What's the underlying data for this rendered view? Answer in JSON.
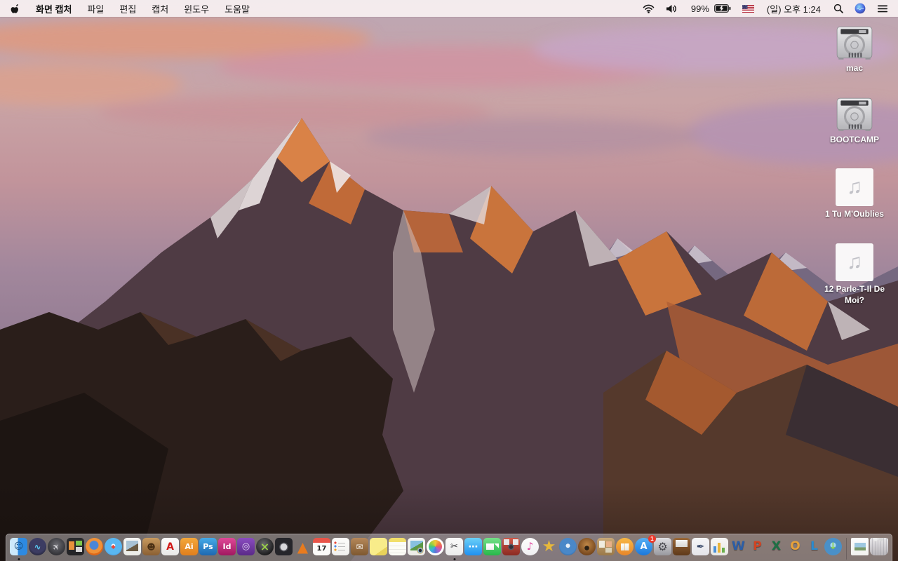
{
  "menubar": {
    "app_name": "화면 캡처",
    "items": [
      {
        "id": "file",
        "label": "파일"
      },
      {
        "id": "edit",
        "label": "편집"
      },
      {
        "id": "capture",
        "label": "캡처"
      },
      {
        "id": "window",
        "label": "윈도우"
      },
      {
        "id": "help",
        "label": "도움말"
      }
    ],
    "status": {
      "battery_percent": "99%",
      "clock": "(일) 오후 1:24"
    }
  },
  "desktop": {
    "icons": [
      {
        "name": "mac-volume",
        "type": "drive",
        "label": "mac"
      },
      {
        "name": "bootcamp-volume",
        "type": "drive",
        "label": "BOOTCAMP"
      },
      {
        "name": "audio-file-1",
        "type": "audio",
        "glyph": "♫",
        "label": "1 Tu M'Oublies"
      },
      {
        "name": "audio-file-2",
        "type": "audio",
        "glyph": "♫",
        "label": "12 Parle-T-Il De Moi?"
      }
    ]
  },
  "dock": {
    "items": [
      {
        "name": "finder",
        "title": "Finder",
        "bg": "linear-gradient(90deg,#cde9fb 0 46%,#2e8ae0 46%)",
        "glyph": "☺",
        "fg": "#1a4e7e",
        "fs": 13,
        "running": true
      },
      {
        "name": "siri",
        "title": "Siri",
        "shape": "circle",
        "bg": "radial-gradient(circle at 50% 40%,#3c3c62 0 55%,#14141f 100%)",
        "glyph": "∿",
        "fg": "#58c8f0",
        "fs": 12
      },
      {
        "name": "launchpad",
        "title": "Launchpad",
        "shape": "circle",
        "bg": "radial-gradient(circle at 50% 40%,#6e6e74,#2e2e33 78%)",
        "glyph": "✈",
        "fg": "#d8d8dc",
        "fs": 12,
        "rot": -45
      },
      {
        "name": "mission-control",
        "title": "Mission Control",
        "bg": "linear-gradient(#e8923a,#e8923a) 3px 5px/8px 12px no-repeat,linear-gradient(#7ec84a,#7ec84a) 13px 4px/9px 7px no-repeat,linear-gradient(#d8d8d8,#d8d8d8) 13px 13px/9px 7px no-repeat,linear-gradient(#2b2b2e,#232326)"
      },
      {
        "name": "firefox",
        "title": "Firefox",
        "shape": "circle",
        "bg": "radial-gradient(circle at 48% 42%,#4a86d8 0 30%,#f09238 36% 60%,#e06818 62% 100%)"
      },
      {
        "name": "safari",
        "title": "Safari",
        "shape": "circle",
        "bg": "radial-gradient(circle at 50% 45%,#f8fbff 0 14%,#59b7f2 16% 62%,#2e7cd6 100%)",
        "glyph": "◆",
        "fg": "#e84838",
        "fs": 8
      },
      {
        "name": "preview",
        "title": "Preview",
        "bg": "linear-gradient(150deg,#a8c2d4 0 55%,#6a5a42 55%) 4px 4px/17px 15px no-repeat,linear-gradient(#f7f7f5,#ebebe7)"
      },
      {
        "name": "contacts",
        "title": "Contacts",
        "bg": "linear-gradient(#c89a5e,#8a5f33)",
        "glyph": "☻",
        "fg": "#4a3014",
        "fs": 12
      },
      {
        "name": "acrobat-reader",
        "title": "Adobe Acrobat Reader",
        "bg": "linear-gradient(#fdfdfd,#e8e8e8)",
        "glyph": "A",
        "fg": "#d01818",
        "fs": 14
      },
      {
        "name": "illustrator",
        "title": "Adobe Illustrator",
        "bg": "linear-gradient(#f3a73a,#e07f1e)",
        "glyph": "Ai",
        "fg": "#ffffff",
        "fs": 11
      },
      {
        "name": "photoshop",
        "title": "Adobe Photoshop",
        "bg": "linear-gradient(#45aae8,#1e68b0)",
        "glyph": "Ps",
        "fg": "#ffffff",
        "fs": 11
      },
      {
        "name": "indesign",
        "title": "Adobe InDesign",
        "bg": "linear-gradient(#e04898,#a01860)",
        "glyph": "Id",
        "fg": "#ffffff",
        "fs": 11
      },
      {
        "name": "toast",
        "title": "Toast Titanium",
        "bg": "linear-gradient(#8a4cc0,#5a2a88)",
        "glyph": "◎",
        "fg": "#e8d8f8",
        "fs": 13
      },
      {
        "name": "sphere-x-app",
        "title": "Utility with X logo",
        "shape": "circle",
        "bg": "radial-gradient(circle at 42% 35%,#6a6a6e,#141416 80%)",
        "glyph": "×",
        "fg": "#9ad04a",
        "fs": 16
      },
      {
        "name": "disk-tool",
        "title": "Disk tool",
        "bg": "radial-gradient(circle at 50% 52%,#d8d8dc 0 26%,#55555c 28% 34%,#26262b 36%)"
      },
      {
        "name": "vlc",
        "title": "VLC",
        "bg": "none",
        "glyph": "▲",
        "fg": "#e87b1e",
        "fs": 20
      },
      {
        "name": "calendar",
        "title": "Calendar",
        "bg": "linear-gradient(#e85448 0 7px,#fbfbf9 7px)",
        "glyph": "17",
        "fg": "#222222",
        "fs": 10,
        "gtop": 6
      },
      {
        "name": "reminders",
        "title": "Reminders",
        "bg": "radial-gradient(circle 1.5px at 5px 7px,#e84838 98%,transparent),radial-gradient(circle 1.5px at 5px 12px,#4a88e8 98%,transparent),radial-gradient(circle 1.5px at 5px 17px,#f0a028 98%,transparent),linear-gradient(#bbbbbb,#bbbbbb) 9px 6.5px/10px 1px no-repeat,linear-gradient(#bbbbbb,#bbbbbb) 9px 11.5px/10px 1px no-repeat,linear-gradient(#bbbbbb,#bbbbbb) 9px 16.5px/10px 1px no-repeat,linear-gradient(#fdfdfb,#f0f0ee)"
      },
      {
        "name": "archive-box-app",
        "title": "Box with envelope app",
        "bg": "linear-gradient(#b5885a,#7e5830)",
        "glyph": "✉",
        "fg": "#f4f0e8",
        "fs": 12
      },
      {
        "name": "stickies",
        "title": "Stickies",
        "bg": "linear-gradient(145deg,#f8ec8a 0 70%,#e8d25a 70%)"
      },
      {
        "name": "notes",
        "title": "Notes",
        "bg": "linear-gradient(#f2df6a 0 6px,#fcfcf6 6px 11px,#e8e8e2 11px 12px,#fcfcf6 12px 16px,#e8e8e2 16px 17px,#fcfcf6 17px 21px,#e8e8e2 21px 22px,#fcfcf6 22px)"
      },
      {
        "name": "iphoto",
        "title": "iPhoto",
        "bg": "radial-gradient(circle 4.5px at 18px 18px,#2a2a30 0 2px,#88b8d8 2.5px 3.5px,#c89838 4px,transparent 5px),linear-gradient(150deg,#88c0e0 0 50%,#5a9848 50%) 3.5px 3.5px/18px 14px no-repeat,linear-gradient(#f8f8f6,#eaeae6)"
      },
      {
        "name": "photos",
        "title": "Photos",
        "shape": "circle",
        "bg": "conic-gradient(#f0c83a,#ef8a3a,#e85a70,#b060c8,#5a78d8,#3ab0e0,#4ac878,#a8d03a,#f0c83a)",
        "bcolor": "#ffffff"
      },
      {
        "name": "screen-capture-grab",
        "title": "화면 캡처 (Grab)",
        "bg": "linear-gradient(#fafafa,#ececec)",
        "glyph": "✂",
        "fg": "#3a3a3e",
        "fs": 13,
        "running": true
      },
      {
        "name": "messages",
        "title": "Messages",
        "bg": "linear-gradient(#6ad0f8,#2090f0)",
        "glyph": "⋯",
        "fg": "#ffffff",
        "fs": 14
      },
      {
        "name": "facetime",
        "title": "FaceTime",
        "bg": "linear-gradient(#ffffff,#f0f0f0) 4px 8px/11px 9px no-repeat,linear-gradient(45deg,transparent 0 58%,#ffffff 60%) 15px 8px/7px 9px no-repeat,linear-gradient(#74e088,#28b84a)"
      },
      {
        "name": "photo-booth",
        "title": "Photo Booth",
        "bg": "radial-gradient(circle 5px at 12.5px 13px,#303038 0 2.5px,#585864 3px 4px,transparent 4.5px),linear-gradient(#e8e8e8,#e8e8e8) 2px 2px/8px 8px no-repeat,linear-gradient(#e8e8e8,#e8e8e8) 15px 2px/8px 8px no-repeat,linear-gradient(#d05848,#8a2a22)"
      },
      {
        "name": "itunes",
        "title": "iTunes",
        "shape": "circle",
        "bg": "linear-gradient(#fdfdfd,#f0f0f2)",
        "glyph": "♪",
        "fg": "#e0409a",
        "fs": 15
      },
      {
        "name": "imovie-classic",
        "title": "iMovie (star)",
        "bg": "none",
        "glyph": "★",
        "fg": "#e8b83a",
        "fs": 22
      },
      {
        "name": "idvd",
        "title": "iDVD",
        "shape": "circle",
        "bg": "radial-gradient(circle at 50% 45%,#e8f0f8 0 15%,#4a88c8 17% 60%,#1e4a80 100%)"
      },
      {
        "name": "garageband",
        "title": "GarageBand",
        "shape": "circle",
        "bg": "radial-gradient(circle 3.5px at 50% 58%,#2a2014 0 3px,transparent 3.5px),radial-gradient(circle at 50% 40%,#c08848,#6a3c16 85%)"
      },
      {
        "name": "pinboard-app",
        "title": "Corkboard app",
        "bg": "linear-gradient(#f0ece0,#f0ece0) 3px 4px/8px 10px no-repeat,linear-gradient(#e8b088,#e8b088) 13px 5px/8px 8px no-repeat,linear-gradient(#d8d0b8,#d8d0b8) 12px 14px/9px 7px no-repeat,linear-gradient(#c8a878,#9a7848)"
      },
      {
        "name": "ibooks",
        "title": "iBooks",
        "shape": "circle",
        "bg": "linear-gradient(#fdfdf8,#e8e8e0) 6.5px 8px/5.5px 10px no-repeat,linear-gradient(#fdfdf8,#e8e8e0) 13px 8px/5.5px 10px no-repeat,linear-gradient(#f8b844,#e8862a)"
      },
      {
        "name": "app-store",
        "title": "App Store",
        "shape": "circle",
        "bg": "linear-gradient(#58b0f4,#1a78dc)",
        "glyph": "A",
        "fg": "#ffffff",
        "fs": 13,
        "badge": "1"
      },
      {
        "name": "system-preferences",
        "title": "System Preferences",
        "bg": "linear-gradient(#e0e0e4,#98989e)",
        "glyph": "⚙",
        "fg": "#4a4a50",
        "fs": 16
      },
      {
        "name": "keynote",
        "title": "Keynote",
        "bg": "linear-gradient(#f4f4f2,#d8d8d4) 4px 3px/17px 10px no-repeat,linear-gradient(#9a6838,#5f3a1a)"
      },
      {
        "name": "pages",
        "title": "Pages",
        "bg": "linear-gradient(#f6f6f8,#e4e4ea)",
        "glyph": "✒",
        "fg": "#3a4a6a",
        "fs": 14
      },
      {
        "name": "numbers",
        "title": "Numbers",
        "bg": "linear-gradient(#4a90d8,#4a90d8) 4px 12px/4px 9px no-repeat,linear-gradient(#e8b53a,#e8b53a) 10px 7px/4px 14px no-repeat,linear-gradient(#6ab04c,#6ab04c) 16px 14px/4px 7px no-repeat,linear-gradient(#f8f8f6,#e8e8e4)"
      },
      {
        "name": "word",
        "title": "Microsoft Word",
        "bg": "none",
        "cls": "g3d",
        "glyph": "W",
        "fg": "#2b5ea8",
        "fs": 17
      },
      {
        "name": "powerpoint",
        "title": "Microsoft PowerPoint",
        "bg": "none",
        "cls": "g3d",
        "glyph": "P",
        "fg": "#d04423",
        "fs": 17
      },
      {
        "name": "excel",
        "title": "Microsoft Excel",
        "bg": "none",
        "cls": "g3d",
        "glyph": "X",
        "fg": "#1e7145",
        "fs": 17
      },
      {
        "name": "outlook",
        "title": "Microsoft Outlook",
        "bg": "none",
        "cls": "g3d",
        "glyph": "O",
        "fg": "#e8a23a",
        "fs": 17
      },
      {
        "name": "lync",
        "title": "Microsoft Lync",
        "bg": "none",
        "cls": "g3d",
        "glyph": "L",
        "fg": "#2b8cd0",
        "fs": 17
      },
      {
        "name": "globe-download-app",
        "title": "Globe download app",
        "shape": "circle",
        "bg": "radial-gradient(circle at 50% 42%,#a8d8f0 0 20%,#4a90c8 22% 75%,#2a5a88 100%)",
        "glyph": "↓",
        "fg": "#8ad048",
        "fs": 13
      },
      {
        "divider": true
      },
      {
        "name": "screenshot-file",
        "title": "Screenshot document",
        "cls": "doc",
        "bg": "linear-gradient(180deg,#9ec8e0 0 60%,#7a9a6a 60%) 4.5px 7px/16px 11px no-repeat,linear-gradient(#fdfdfd,#f2f2f0)"
      },
      {
        "name": "trash",
        "title": "Trash (full)",
        "cls": "trash",
        "bg": "radial-gradient(circle 3px at 8px 2px,#ececec 0 2.5px,transparent 3px),radial-gradient(circle 3px at 16px 2px,#d8d8d8 0 2.5px,transparent 3px),radial-gradient(circle 2.5px at 12px 1px,#e0e0e0 0 2px,transparent 2.5px),repeating-linear-gradient(90deg,rgba(255,255,255,0) 0 3px,rgba(120,120,130,0.28) 3px 4px),linear-gradient(rgba(246,246,249,0.88),rgba(204,204,212,0.72))"
      }
    ]
  },
  "colors": {
    "menubar_bg": "#f7f0f1",
    "dock_bg": "rgba(214,209,211,0.48)",
    "badge_red": "#ea392b",
    "sky_top": "#c9a4a6",
    "sunlit_rock": "#c9743c",
    "shadow_rock": "#4f3b44",
    "foreground_rock": "#2a1e1a"
  }
}
